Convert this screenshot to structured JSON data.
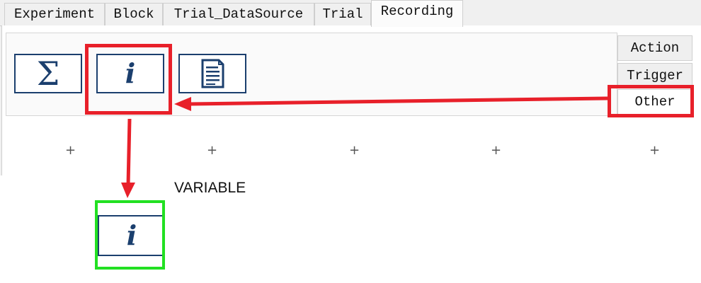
{
  "tabs": [
    {
      "label": "Experiment"
    },
    {
      "label": "Block"
    },
    {
      "label": "Trial_DataSource"
    },
    {
      "label": "Trial"
    },
    {
      "label": "Recording"
    }
  ],
  "active_tab": "Recording",
  "toolbar": {
    "tools": [
      {
        "glyph": "Σ",
        "icon": "sigma-icon"
      },
      {
        "glyph": "i",
        "icon": "info-icon"
      },
      {
        "glyph": "",
        "icon": "document-icon"
      }
    ]
  },
  "side_tabs": [
    {
      "label": "Action"
    },
    {
      "label": "Trigger"
    },
    {
      "label": "Other"
    }
  ],
  "canvas": {
    "node_label": "VARIABLE",
    "node_glyph": "i"
  },
  "colors": {
    "icon_blue": "#1b3f6e",
    "highlight_red": "#e8202a",
    "highlight_green": "#22e022"
  }
}
